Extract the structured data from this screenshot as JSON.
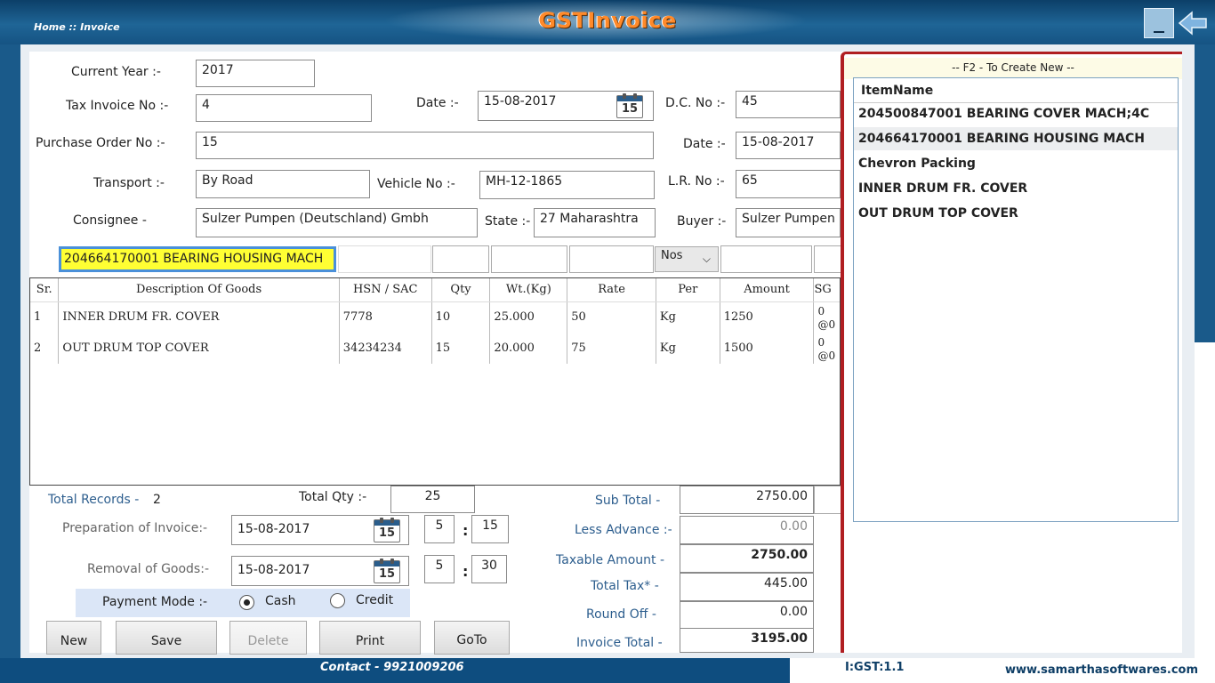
{
  "header": {
    "breadcrumb": "Home :: Invoice",
    "title": "GSTInvoice",
    "minimize_icon": "minimize-icon",
    "back_icon": "back-arrow-icon"
  },
  "form": {
    "current_year": {
      "label": "Current Year :-",
      "value": "2017"
    },
    "tax_invoice_no": {
      "label": "Tax Invoice No :-",
      "value": "4"
    },
    "date": {
      "label": "Date :-",
      "value": "15-08-2017"
    },
    "dc_no": {
      "label": "D.C. No :-",
      "value": "45"
    },
    "purchase_order_no": {
      "label": "Purchase Order No :-",
      "value": "15"
    },
    "po_date": {
      "label": "Date :-",
      "value": "15-08-2017"
    },
    "transport": {
      "label": "Transport :-",
      "value": "By Road"
    },
    "vehicle_no": {
      "label": "Vehicle No :-",
      "value": "MH-12-1865"
    },
    "lr_no": {
      "label": "L.R. No :-",
      "value": "65"
    },
    "consignee": {
      "label": "Consignee -",
      "value": "Sulzer Pumpen (Deutschland) Gmbh"
    },
    "state": {
      "label": "State :-",
      "value": "27 Maharashtra"
    },
    "buyer": {
      "label": "Buyer :-",
      "value": "Sulzer Pumpen"
    },
    "calendar_day": "15"
  },
  "item_entry": {
    "description": "204664170001 BEARING HOUSING MACH",
    "unit": "Nos"
  },
  "grid": {
    "columns": [
      "Sr.",
      "Description Of Goods",
      "HSN / SAC",
      "Qty",
      "Wt.(Kg)",
      "Rate",
      "Per",
      "Amount",
      "SG"
    ],
    "rows": [
      {
        "sr": "1",
        "description": "INNER DRUM FR. COVER",
        "hsn": "7778",
        "qty": "10",
        "wt": "25.000",
        "rate": "50",
        "per": "Kg",
        "amount": "1250",
        "sg1": "0",
        "sg2": "@0"
      },
      {
        "sr": "2",
        "description": "OUT DRUM TOP COVER",
        "hsn": "34234234",
        "qty": "15",
        "wt": "20.000",
        "rate": "75",
        "per": "Kg",
        "amount": "1500",
        "sg1": "0",
        "sg2": "@0"
      }
    ]
  },
  "summary": {
    "total_records_label": "Total Records -",
    "total_records": "2",
    "total_qty_label": "Total Qty :-",
    "total_qty": "25",
    "preparation_label": "Preparation of Invoice:-",
    "preparation_date": "15-08-2017",
    "preparation_hour": "5",
    "preparation_min": "15",
    "removal_label": "Removal of Goods:-",
    "removal_date": "15-08-2017",
    "removal_hour": "5",
    "removal_min": "30",
    "time_sep": ":",
    "payment_label": "Payment Mode :-",
    "payment_cash": "Cash",
    "payment_credit": "Credit"
  },
  "totals": {
    "sub_total_label": "Sub Total -",
    "sub_total": "2750.00",
    "less_advance_label": "Less Advance :-",
    "less_advance": "0.00",
    "taxable_amount_label": "Taxable Amount -",
    "taxable_amount": "2750.00",
    "total_tax_label": "Total Tax* -",
    "total_tax": "445.00",
    "round_off_label": "Round Off -",
    "round_off": "0.00",
    "invoice_total_label": "Invoice Total -",
    "invoice_total": "3195.00"
  },
  "buttons": {
    "new": "New",
    "save": "Save",
    "delete": "Delete",
    "print": "Print",
    "goto": "GoTo"
  },
  "dropdown": {
    "hint": "-- F2 - To Create New --",
    "header": "ItemName",
    "items": [
      "204500847001 BEARING COVER MACH;4C",
      "204664170001 BEARING HOUSING MACH",
      "Chevron Packing",
      "INNER DRUM FR. COVER",
      "OUT DRUM TOP COVER"
    ]
  },
  "footer": {
    "contact": "Contact - 9921009206",
    "version": "I:GST:1.1",
    "website": "www.samarthasoftwares.com"
  },
  "colors": {
    "header_bg": "#1f6596",
    "title": "#ff8a2a",
    "highlight": "#ffff33",
    "dropdown_border": "#b01e22"
  }
}
